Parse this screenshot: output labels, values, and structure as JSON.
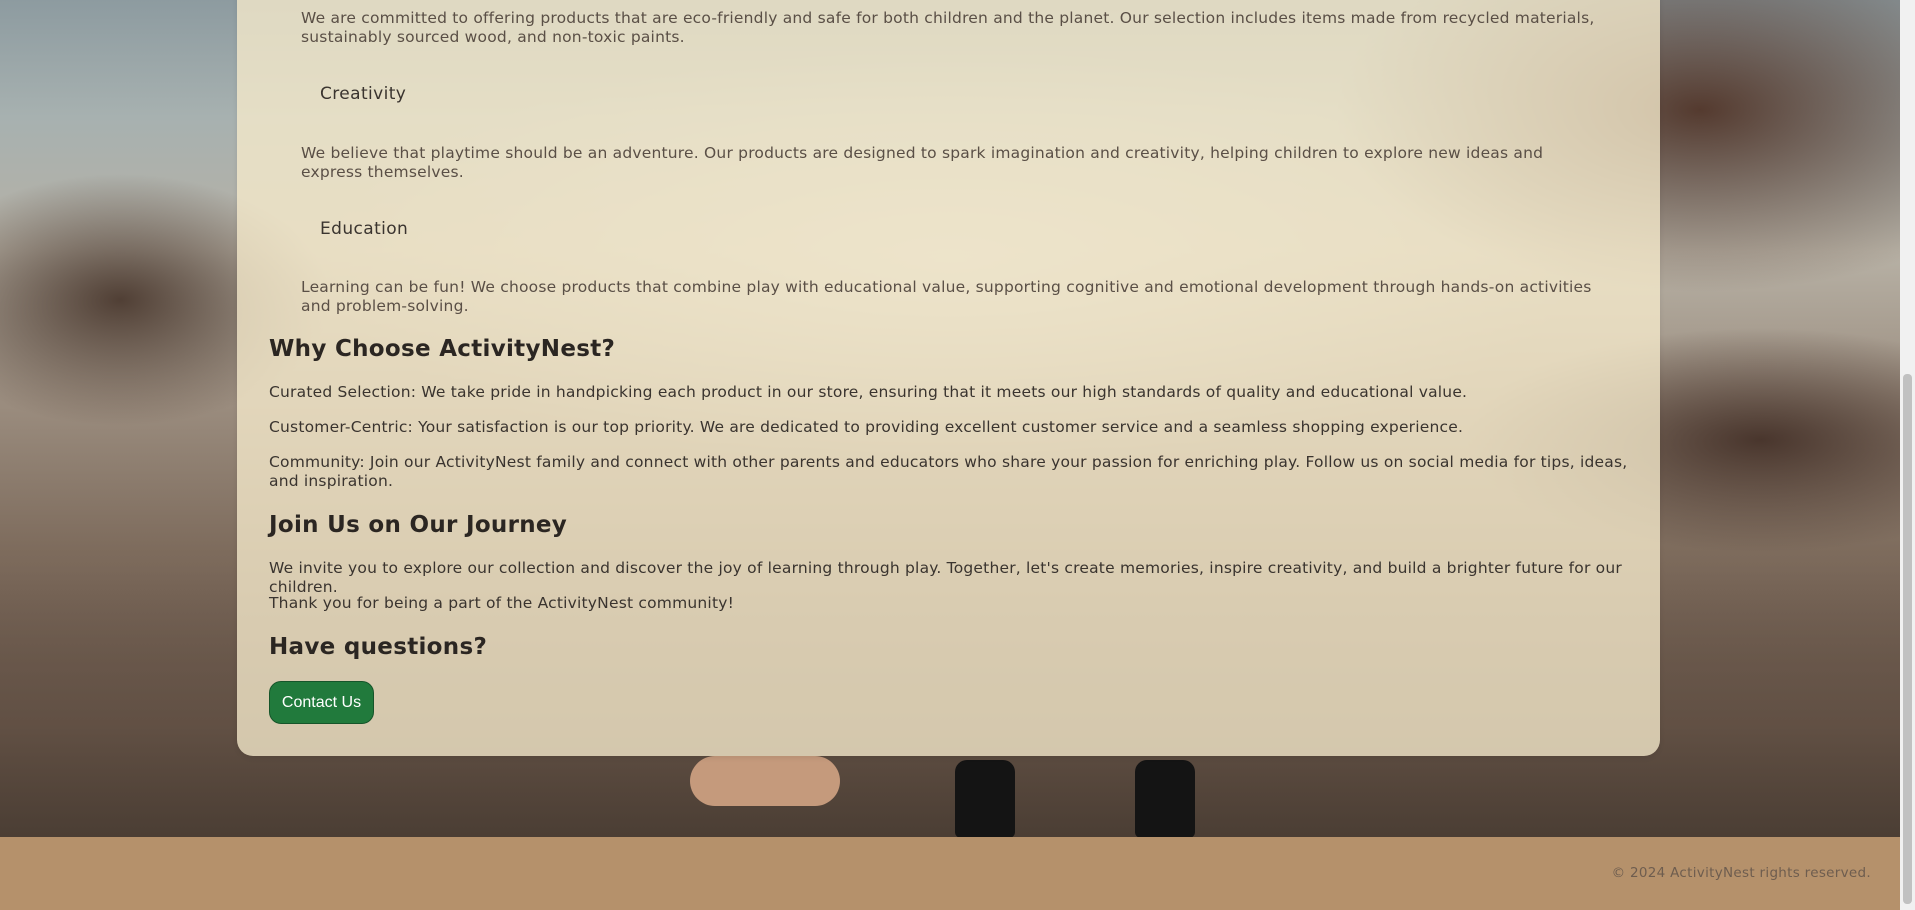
{
  "values_section": {
    "intro_text": "We are committed to offering products that are eco-friendly and safe for both children and the planet. Our selection includes items made from recycled materials, sustainably sourced wood, and non-toxic paints.",
    "items": [
      {
        "heading": "Creativity",
        "text": "We believe that playtime should be an adventure. Our products are designed to spark imagination and creativity, helping children to explore new ideas and express themselves."
      },
      {
        "heading": "Education",
        "text": "Learning can be fun! We choose products that combine play with educational value, supporting cognitive and emotional development through hands-on activities and problem-solving."
      }
    ]
  },
  "why_section": {
    "heading": "Why Choose ActivityNest?",
    "points": [
      "Curated Selection: We take pride in handpicking each product in our store, ensuring that it meets our high standards of quality and educational value.",
      "Customer-Centric: Your satisfaction is our top priority. We are dedicated to providing excellent customer service and a seamless shopping experience.",
      "Community: Join our ActivityNest family and connect with other parents and educators who share your passion for enriching play. Follow us on social media for tips, ideas, and inspiration."
    ]
  },
  "journey_section": {
    "heading": "Join Us on Our Journey",
    "text_1": "We invite you to explore our collection and discover the joy of learning through play. Together, let's create memories, inspire creativity, and build a brighter future for our children.",
    "text_2": "Thank you for being a part of the ActivityNest community!"
  },
  "questions_section": {
    "heading": "Have questions?",
    "button_label": "Contact Us"
  },
  "footer": {
    "text": "© 2024 ActivityNest rights reserved."
  },
  "colors": {
    "button": "#217a3c",
    "footer": "#b5916b",
    "card": "#f6ebcc"
  }
}
